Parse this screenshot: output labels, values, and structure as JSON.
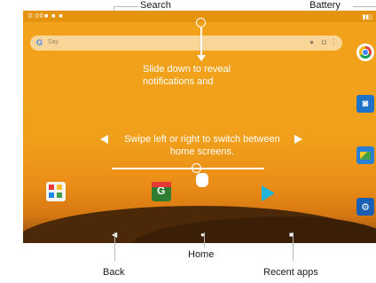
{
  "callouts": {
    "search": "Search",
    "battery": "Battery",
    "home": "Home",
    "back": "Back",
    "recent_apps": "Recent apps"
  },
  "instructions": {
    "slide_down": "Slide down to reveal notifications and",
    "swipe": "Swipe left or right to switch between home screens."
  },
  "search_bar": {
    "hint": "Say"
  },
  "status_bar": {
    "time": "0:00"
  },
  "icons": {
    "search_logo": "google-g-icon",
    "mic": "mic-icon",
    "camera": "camera-icon",
    "more": "more-icon",
    "dock": [
      "chrome-icon",
      "camera-icon",
      "gallery-icon",
      "settings-icon"
    ],
    "home_apps": [
      "apps-icon",
      "play-store-icon",
      "play-movies-icon"
    ],
    "nav": [
      "back-icon",
      "home-icon",
      "recent-apps-icon"
    ]
  },
  "colors": {
    "wallpaper": "#f2a31a",
    "guide_line": "#b9b9b9",
    "callout_text": "#1a1a1a"
  }
}
